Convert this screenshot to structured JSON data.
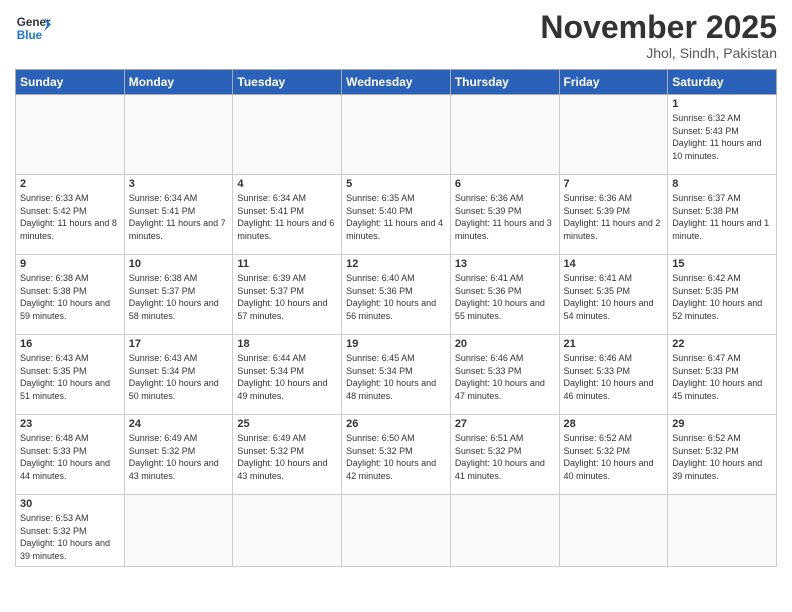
{
  "header": {
    "logo_general": "General",
    "logo_blue": "Blue",
    "month_title": "November 2025",
    "location": "Jhol, Sindh, Pakistan"
  },
  "days_of_week": [
    "Sunday",
    "Monday",
    "Tuesday",
    "Wednesday",
    "Thursday",
    "Friday",
    "Saturday"
  ],
  "weeks": [
    [
      {
        "day": "",
        "content": ""
      },
      {
        "day": "",
        "content": ""
      },
      {
        "day": "",
        "content": ""
      },
      {
        "day": "",
        "content": ""
      },
      {
        "day": "",
        "content": ""
      },
      {
        "day": "",
        "content": ""
      },
      {
        "day": "1",
        "content": "Sunrise: 6:32 AM\nSunset: 5:43 PM\nDaylight: 11 hours and 10 minutes."
      }
    ],
    [
      {
        "day": "2",
        "content": "Sunrise: 6:33 AM\nSunset: 5:42 PM\nDaylight: 11 hours and 8 minutes."
      },
      {
        "day": "3",
        "content": "Sunrise: 6:34 AM\nSunset: 5:41 PM\nDaylight: 11 hours and 7 minutes."
      },
      {
        "day": "4",
        "content": "Sunrise: 6:34 AM\nSunset: 5:41 PM\nDaylight: 11 hours and 6 minutes."
      },
      {
        "day": "5",
        "content": "Sunrise: 6:35 AM\nSunset: 5:40 PM\nDaylight: 11 hours and 4 minutes."
      },
      {
        "day": "6",
        "content": "Sunrise: 6:36 AM\nSunset: 5:39 PM\nDaylight: 11 hours and 3 minutes."
      },
      {
        "day": "7",
        "content": "Sunrise: 6:36 AM\nSunset: 5:39 PM\nDaylight: 11 hours and 2 minutes."
      },
      {
        "day": "8",
        "content": "Sunrise: 6:37 AM\nSunset: 5:38 PM\nDaylight: 11 hours and 1 minute."
      }
    ],
    [
      {
        "day": "9",
        "content": "Sunrise: 6:38 AM\nSunset: 5:38 PM\nDaylight: 10 hours and 59 minutes."
      },
      {
        "day": "10",
        "content": "Sunrise: 6:38 AM\nSunset: 5:37 PM\nDaylight: 10 hours and 58 minutes."
      },
      {
        "day": "11",
        "content": "Sunrise: 6:39 AM\nSunset: 5:37 PM\nDaylight: 10 hours and 57 minutes."
      },
      {
        "day": "12",
        "content": "Sunrise: 6:40 AM\nSunset: 5:36 PM\nDaylight: 10 hours and 56 minutes."
      },
      {
        "day": "13",
        "content": "Sunrise: 6:41 AM\nSunset: 5:36 PM\nDaylight: 10 hours and 55 minutes."
      },
      {
        "day": "14",
        "content": "Sunrise: 6:41 AM\nSunset: 5:35 PM\nDaylight: 10 hours and 54 minutes."
      },
      {
        "day": "15",
        "content": "Sunrise: 6:42 AM\nSunset: 5:35 PM\nDaylight: 10 hours and 52 minutes."
      }
    ],
    [
      {
        "day": "16",
        "content": "Sunrise: 6:43 AM\nSunset: 5:35 PM\nDaylight: 10 hours and 51 minutes."
      },
      {
        "day": "17",
        "content": "Sunrise: 6:43 AM\nSunset: 5:34 PM\nDaylight: 10 hours and 50 minutes."
      },
      {
        "day": "18",
        "content": "Sunrise: 6:44 AM\nSunset: 5:34 PM\nDaylight: 10 hours and 49 minutes."
      },
      {
        "day": "19",
        "content": "Sunrise: 6:45 AM\nSunset: 5:34 PM\nDaylight: 10 hours and 48 minutes."
      },
      {
        "day": "20",
        "content": "Sunrise: 6:46 AM\nSunset: 5:33 PM\nDaylight: 10 hours and 47 minutes."
      },
      {
        "day": "21",
        "content": "Sunrise: 6:46 AM\nSunset: 5:33 PM\nDaylight: 10 hours and 46 minutes."
      },
      {
        "day": "22",
        "content": "Sunrise: 6:47 AM\nSunset: 5:33 PM\nDaylight: 10 hours and 45 minutes."
      }
    ],
    [
      {
        "day": "23",
        "content": "Sunrise: 6:48 AM\nSunset: 5:33 PM\nDaylight: 10 hours and 44 minutes."
      },
      {
        "day": "24",
        "content": "Sunrise: 6:49 AM\nSunset: 5:32 PM\nDaylight: 10 hours and 43 minutes."
      },
      {
        "day": "25",
        "content": "Sunrise: 6:49 AM\nSunset: 5:32 PM\nDaylight: 10 hours and 43 minutes."
      },
      {
        "day": "26",
        "content": "Sunrise: 6:50 AM\nSunset: 5:32 PM\nDaylight: 10 hours and 42 minutes."
      },
      {
        "day": "27",
        "content": "Sunrise: 6:51 AM\nSunset: 5:32 PM\nDaylight: 10 hours and 41 minutes."
      },
      {
        "day": "28",
        "content": "Sunrise: 6:52 AM\nSunset: 5:32 PM\nDaylight: 10 hours and 40 minutes."
      },
      {
        "day": "29",
        "content": "Sunrise: 6:52 AM\nSunset: 5:32 PM\nDaylight: 10 hours and 39 minutes."
      }
    ],
    [
      {
        "day": "30",
        "content": "Sunrise: 6:53 AM\nSunset: 5:32 PM\nDaylight: 10 hours and 39 minutes."
      },
      {
        "day": "",
        "content": ""
      },
      {
        "day": "",
        "content": ""
      },
      {
        "day": "",
        "content": ""
      },
      {
        "day": "",
        "content": ""
      },
      {
        "day": "",
        "content": ""
      },
      {
        "day": "",
        "content": ""
      }
    ]
  ]
}
